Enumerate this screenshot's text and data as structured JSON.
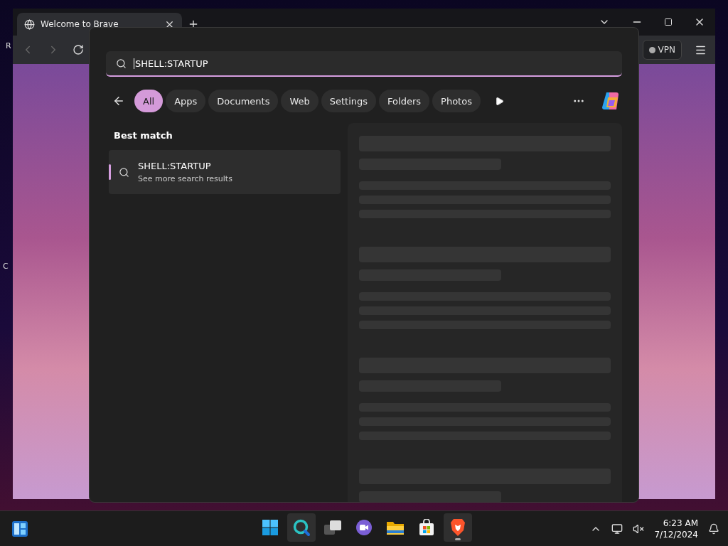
{
  "desktop": {
    "edge_labels": [
      "R",
      "C"
    ]
  },
  "browser": {
    "tab": {
      "title": "Welcome to Brave"
    },
    "vpn_button": {
      "label": "VPN"
    }
  },
  "search": {
    "query": "SHELL:STARTUP",
    "filters": [
      {
        "label": "All",
        "selected": true
      },
      {
        "label": "Apps",
        "selected": false
      },
      {
        "label": "Documents",
        "selected": false
      },
      {
        "label": "Web",
        "selected": false
      },
      {
        "label": "Settings",
        "selected": false
      },
      {
        "label": "Folders",
        "selected": false
      },
      {
        "label": "Photos",
        "selected": false
      }
    ],
    "section_title": "Best match",
    "result": {
      "title": "SHELL:STARTUP",
      "subtitle": "See more search results",
      "selected": true
    }
  },
  "taskbar": {
    "apps": [
      {
        "kind": "start",
        "highlighted": false,
        "running": false
      },
      {
        "kind": "search",
        "highlighted": true,
        "running": false
      },
      {
        "kind": "taskview",
        "highlighted": false,
        "running": false
      },
      {
        "kind": "meet",
        "highlighted": false,
        "running": false
      },
      {
        "kind": "explorer",
        "highlighted": false,
        "running": false
      },
      {
        "kind": "store",
        "highlighted": false,
        "running": false
      },
      {
        "kind": "brave",
        "highlighted": true,
        "running": true
      }
    ],
    "time": "6:23 AM",
    "date": "7/12/2024"
  }
}
